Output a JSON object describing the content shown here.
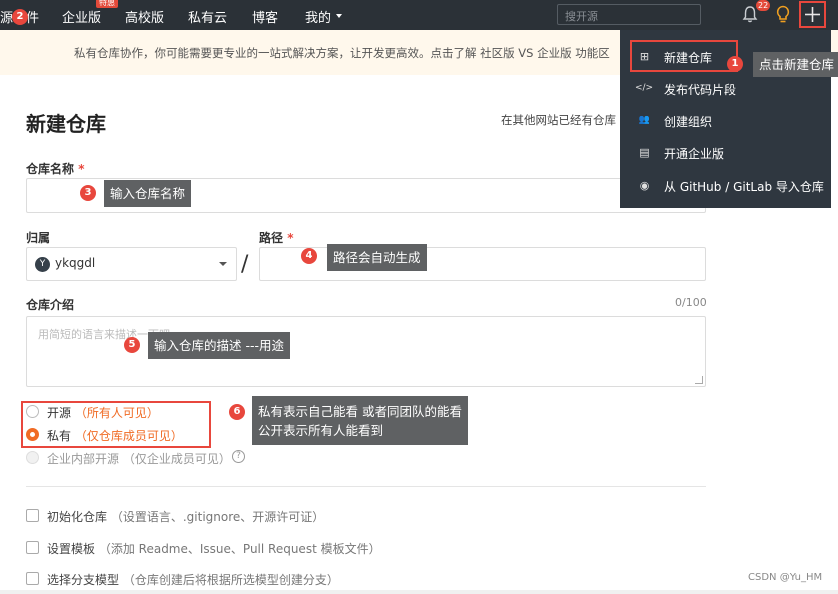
{
  "nav": {
    "items": [
      "源软件",
      "企业版",
      "高校版",
      "私有云",
      "博客",
      "我的"
    ],
    "hot_badge": "特惠",
    "search_placeholder": "搜开源",
    "notification_count": "22",
    "my_dropdown_icon": "caret-down-icon",
    "icons": [
      "bell-icon",
      "lightbulb-icon",
      "plus-icon"
    ]
  },
  "banner": {
    "text": "私有仓库协作，你可能需要更专业的一站式解决方案，让开发更高效。点击了解 社区版 VS 企业版 功能区"
  },
  "form": {
    "title": "新建仓库",
    "import_link": "在其他网站已经有仓库",
    "name_label": "仓库名称",
    "required_mark": "*",
    "owner_label": "归属",
    "owner_avatar_letter": "Y",
    "owner_value": "ykqgdl",
    "path_label": "路径",
    "slash": "/",
    "intro_label": "仓库介绍",
    "intro_counter": "0/100",
    "intro_placeholder": "用简短的语言来描述一下吧",
    "visibility": [
      {
        "label": "开源",
        "hint": "（所有人可见）",
        "checked": false,
        "disabled": false
      },
      {
        "label": "私有",
        "hint": "（仅仓库成员可见）",
        "checked": true,
        "disabled": false
      },
      {
        "label": "企业内部开源",
        "hint": "（仅企业成员可见）",
        "checked": false,
        "disabled": true
      }
    ],
    "help_glyph": "?",
    "options": [
      {
        "label": "初始化仓库",
        "hint": "（设置语言、.gitignore、开源许可证）"
      },
      {
        "label": "设置模板",
        "hint": "（添加 Readme、Issue、Pull Request 模板文件）"
      },
      {
        "label": "选择分支模型",
        "hint": "（仓库创建后将根据所选模型创建分支）"
      }
    ]
  },
  "dropdown": {
    "items": [
      {
        "icon": "new-repo-icon",
        "glyph": "⊞",
        "label": "新建仓库"
      },
      {
        "icon": "code-icon",
        "glyph": "</>",
        "label": "发布代码片段"
      },
      {
        "icon": "group-icon",
        "glyph": "👥",
        "label": "创建组织"
      },
      {
        "icon": "enterprise-icon",
        "glyph": "▤",
        "label": "开通企业版"
      },
      {
        "icon": "github-icon",
        "glyph": "◉",
        "label": "从 GitHub / GitLab 导入仓库"
      }
    ]
  },
  "annotations": {
    "n1": "1",
    "t1": "点击新建仓库",
    "n2": "2",
    "n3": "3",
    "t3": "输入仓库名称",
    "n4": "4",
    "t4": "路径会自动生成",
    "n5": "5",
    "t5": "输入仓库的描述 ---用途",
    "n6": "6",
    "t6a": "私有表示自己能看 或者同团队的能看",
    "t6b": "公开表示所有人能看到"
  },
  "watermark": "CSDN @Yu_HM"
}
